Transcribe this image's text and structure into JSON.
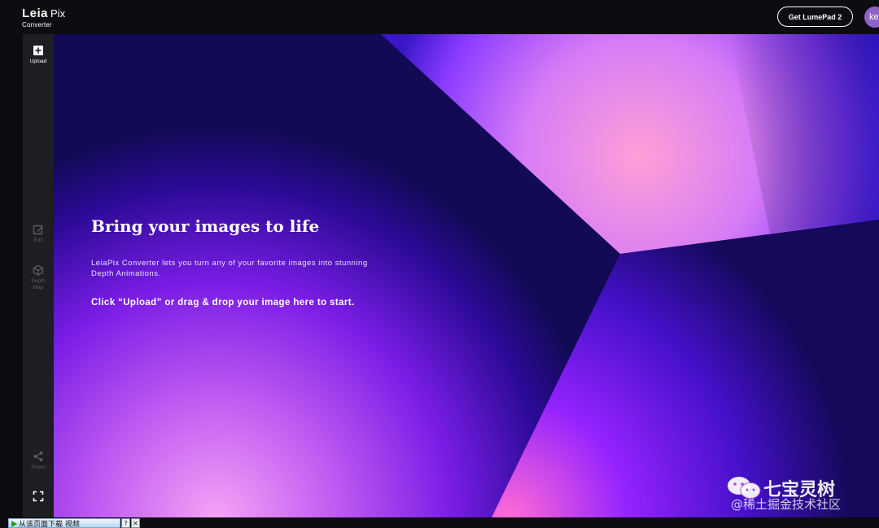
{
  "header": {
    "logo_leia": "Leia",
    "logo_pix": "Pix",
    "logo_subtitle": "Converter",
    "get_button_label": "Get LumePad 2",
    "avatar_initials": "ke",
    "avatar_color": "#8e63c9"
  },
  "sidebar": {
    "items": [
      {
        "label": "Upload",
        "icon": "plus-square-icon",
        "enabled": true
      },
      {
        "label": "Edit",
        "icon": "edit-icon",
        "enabled": false
      },
      {
        "label": "Depth\nMap",
        "icon": "cube-icon",
        "enabled": false
      },
      {
        "label": "Share",
        "icon": "share-icon",
        "enabled": false
      },
      {
        "label": "",
        "icon": "fullscreen-icon",
        "enabled": true
      }
    ]
  },
  "hero": {
    "title": "Bring your images to life",
    "description": "LeiaPix Converter lets you turn any of your favorite images into stunning Depth Animations.",
    "cta": "Click “Upload” or drag & drop your image here to start."
  },
  "watermark": {
    "name": "七宝灵树",
    "sub": "@稀土掘金技术社区"
  },
  "bottom_bar": {
    "download_text": "从该页面下载 视频",
    "help_label": "?",
    "close_label": "✕"
  },
  "colors": {
    "background": "#0c0c10",
    "sidebar": "#1d1d22",
    "hero_dark": "#11084a",
    "hero_pink": "#ff8fd0",
    "hero_violet": "#8a24ff"
  }
}
